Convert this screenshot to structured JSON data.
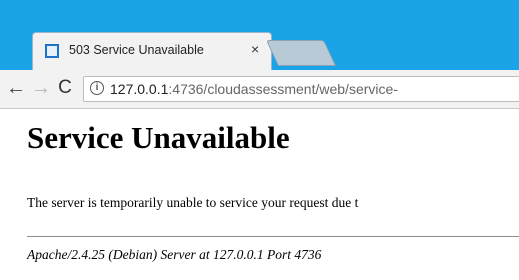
{
  "tab": {
    "title": "503 Service Unavailable",
    "close_glyph": "×",
    "favicon": "page-favicon"
  },
  "toolbar": {
    "back_glyph": "←",
    "forward_glyph": "→",
    "reload_glyph": "C",
    "info_glyph": "i"
  },
  "address_bar": {
    "url_host": "127.0.0.1",
    "url_path": ":4736/cloudassessment/web/service-"
  },
  "page": {
    "heading": "Service Unavailable",
    "paragraph": "The server is temporarily unable to service your request due t",
    "server_signature": "Apache/2.4.25 (Debian) Server at 127.0.0.1 Port 4736"
  },
  "colors": {
    "titlebar": "#1aa3e6",
    "toolbar": "#f2f2f2",
    "page_background": "#ffffff"
  }
}
